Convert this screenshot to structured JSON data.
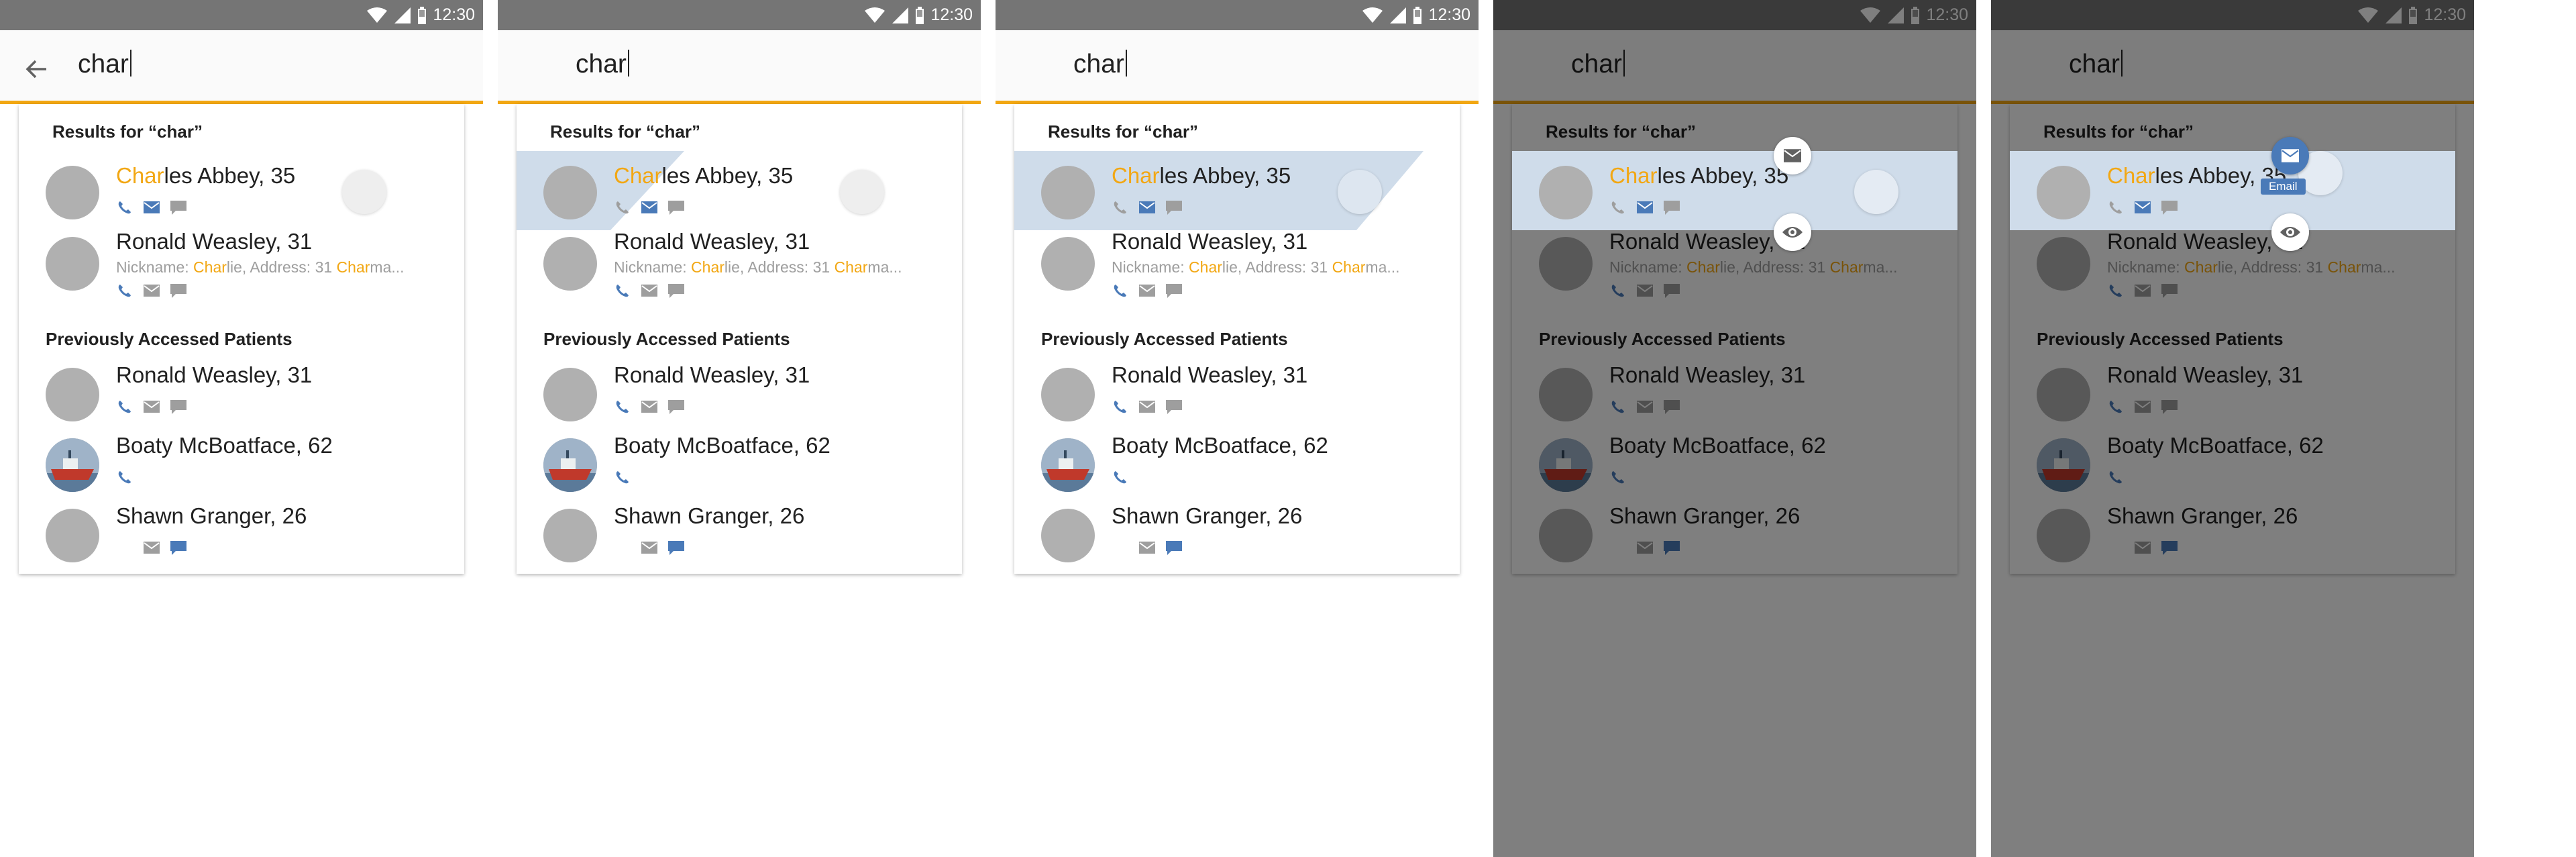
{
  "status": {
    "time": "12:30"
  },
  "search": {
    "query": "char"
  },
  "results": {
    "title": "Results for “char”",
    "items": [
      {
        "name_hl": "Char",
        "name_rest": "les Abbey, 35"
      },
      {
        "name": "Ronald Weasley, 31",
        "detail_a": "Nickname: ",
        "detail_b": "Char",
        "detail_c": "lie, Address: 31 ",
        "detail_d": "Char",
        "detail_e": "ma..."
      }
    ]
  },
  "previous": {
    "title": "Previously Accessed Patients",
    "items": [
      {
        "name": "Ronald Weasley, 31"
      },
      {
        "name": "Boaty McBoatface, 62"
      },
      {
        "name": "Shawn Granger, 26"
      }
    ]
  },
  "actions": {
    "email_tooltip": "Email"
  },
  "colors": {
    "accent": "#f2a713",
    "status_bar": "#757575",
    "selected_row": "#cfdcea",
    "icon_blue": "#4a7ab8",
    "icon_grey": "#9e9e9e"
  },
  "icons": [
    "wifi-icon",
    "cell-signal-icon",
    "battery-icon",
    "back-arrow-icon",
    "phone-icon",
    "email-icon",
    "message-icon",
    "view-eye-icon"
  ]
}
